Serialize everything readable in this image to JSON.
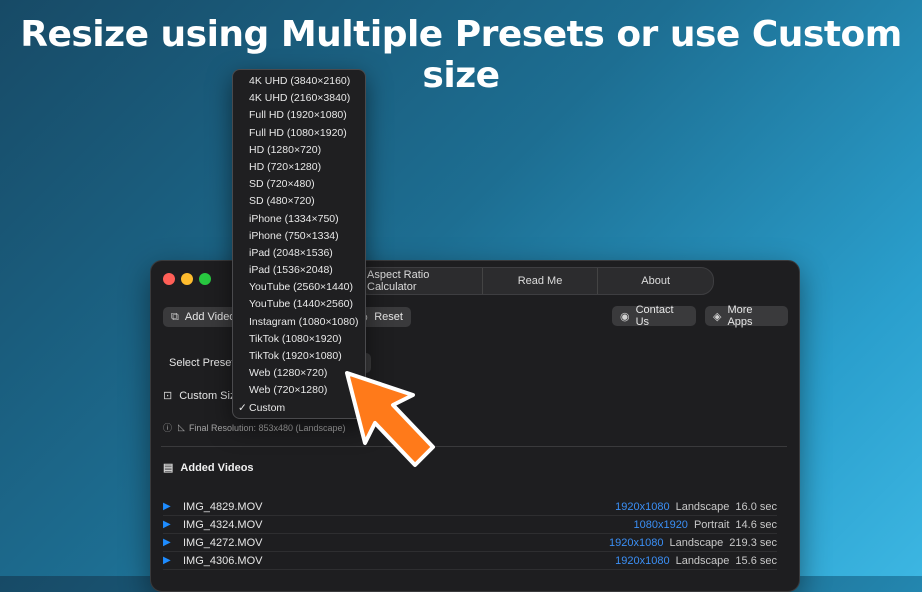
{
  "headline": "Resize using Multiple Presets or use Custom size",
  "colors": {
    "accent": "#3b8ff5",
    "arrow": "#ff7a1a",
    "window_bg": "#1e1e20"
  },
  "window": {
    "tabs": [
      "Aspect Ratio Calculator",
      "Read Me",
      "About"
    ],
    "toolbar": {
      "add_video": "Add Video",
      "reset": "Reset",
      "contact": "Contact Us",
      "more_apps": "More Apps"
    },
    "select_preset_label": "Select Preset:",
    "custom_size_label": "Custom Size",
    "final_resolution": "Final Resolution: 853x480 (Landscape)",
    "added_videos_title": "Added Videos",
    "videos": [
      {
        "name": "IMG_4829.MOV",
        "resolution": "1920x1080",
        "orientation": "Landscape",
        "duration": "16.0 sec"
      },
      {
        "name": "IMG_4324.MOV",
        "resolution": "1080x1920",
        "orientation": "Portrait",
        "duration": "14.6 sec"
      },
      {
        "name": "IMG_4272.MOV",
        "resolution": "1920x1080",
        "orientation": "Landscape",
        "duration": "219.3 sec"
      },
      {
        "name": "IMG_4306.MOV",
        "resolution": "1920x1080",
        "orientation": "Landscape",
        "duration": "15.6 sec"
      }
    ]
  },
  "preset_menu": {
    "items": [
      "4K UHD (3840×2160)",
      "4K UHD (2160×3840)",
      "Full HD (1920×1080)",
      "Full HD (1080×1920)",
      "HD (1280×720)",
      "HD (720×1280)",
      "SD (720×480)",
      "SD (480×720)",
      "iPhone (1334×750)",
      "iPhone (750×1334)",
      "iPad (2048×1536)",
      "iPad (1536×2048)",
      "YouTube (2560×1440)",
      "YouTube (1440×2560)",
      "Instagram (1080×1080)",
      "TikTok (1080×1920)",
      "TikTok (1920×1080)",
      "Web (1280×720)",
      "Web (720×1280)",
      "Custom"
    ],
    "selected": "Custom"
  }
}
